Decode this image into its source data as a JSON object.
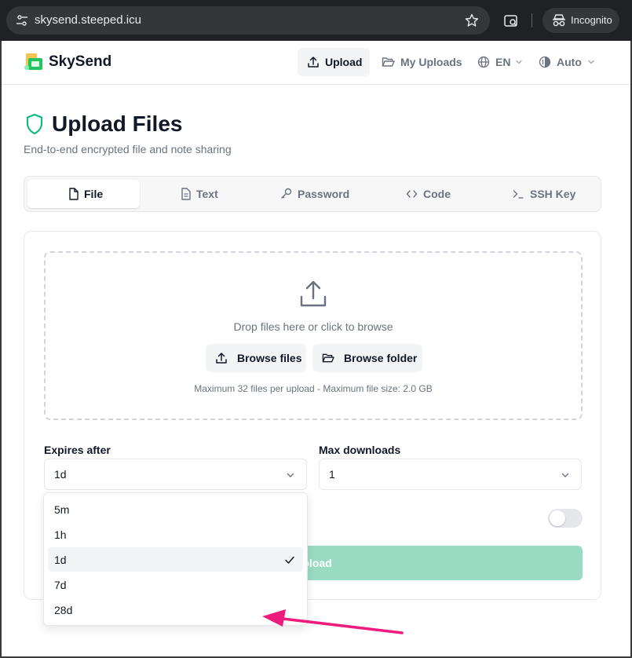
{
  "browser": {
    "url": "skysend.steeped.icu",
    "incognito_label": "Incognito"
  },
  "header": {
    "brand": "SkySend",
    "nav": {
      "upload": "Upload",
      "my_uploads": "My Uploads",
      "language": "EN",
      "theme": "Auto"
    }
  },
  "page": {
    "title": "Upload Files",
    "subtitle": "End-to-end encrypted file and note sharing"
  },
  "tabs": [
    {
      "label": "File",
      "icon": "file-icon",
      "active": true
    },
    {
      "label": "Text",
      "icon": "text-file-icon",
      "active": false
    },
    {
      "label": "Password",
      "icon": "key-icon",
      "active": false
    },
    {
      "label": "Code",
      "icon": "code-icon",
      "active": false
    },
    {
      "label": "SSH Key",
      "icon": "terminal-icon",
      "active": false
    }
  ],
  "dropzone": {
    "text": "Drop files here or click to browse",
    "browse_files": "Browse files",
    "browse_folder": "Browse folder",
    "limit": "Maximum 32 files per upload - Maximum file size: 2.0 GB"
  },
  "form": {
    "expires_label": "Expires after",
    "expires_value": "1d",
    "max_downloads_label": "Max downloads",
    "max_downloads_value": "1",
    "upload_button": "Upload"
  },
  "expires_options": [
    {
      "label": "5m",
      "selected": false
    },
    {
      "label": "1h",
      "selected": false
    },
    {
      "label": "1d",
      "selected": true
    },
    {
      "label": "7d",
      "selected": false
    },
    {
      "label": "28d",
      "selected": false
    }
  ],
  "colors": {
    "accent": "#10b981",
    "upload_button_disabled": "#99dcc3",
    "annotation_arrow": "#ee1c7c"
  }
}
